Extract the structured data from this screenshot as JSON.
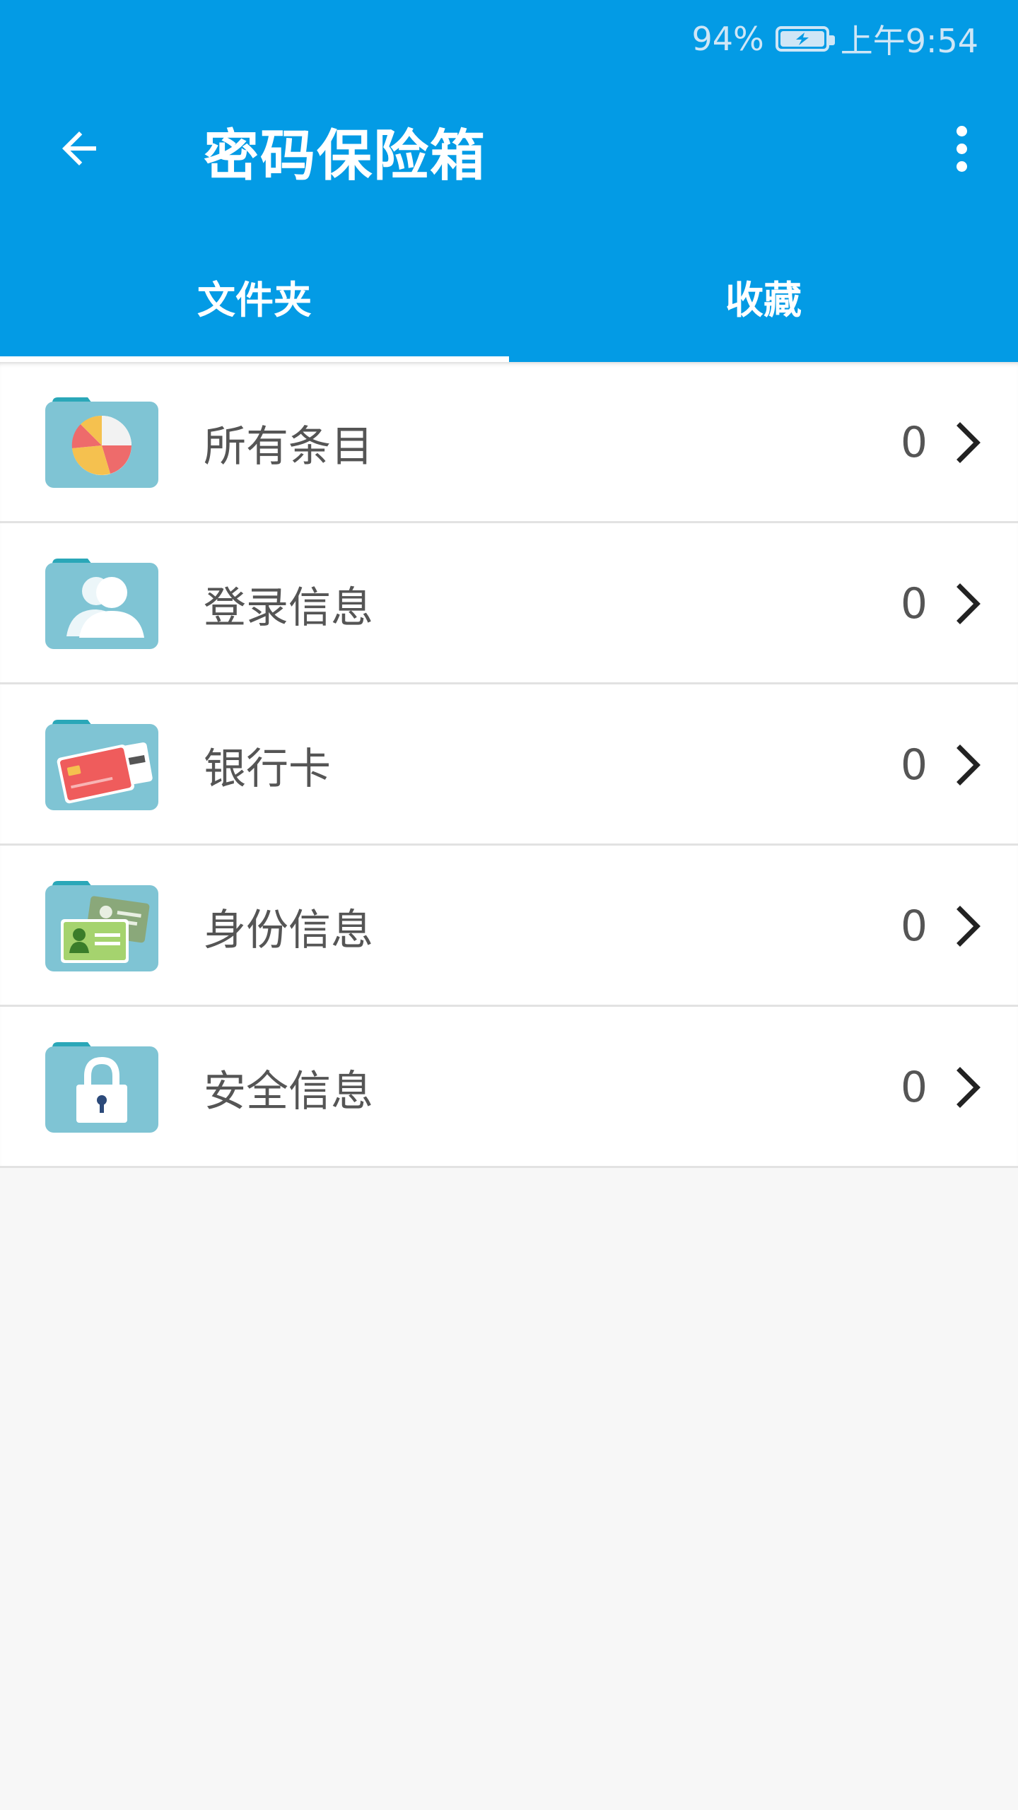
{
  "status_bar": {
    "battery_percent": "94%",
    "time": "上午9:54"
  },
  "toolbar": {
    "title": "密码保险箱",
    "back_icon": "arrow-left-icon",
    "menu_icon": "more-vert-icon"
  },
  "tabs": [
    {
      "label": "文件夹",
      "active": true
    },
    {
      "label": "收藏",
      "active": false
    }
  ],
  "colors": {
    "primary": "#039be5",
    "folder": "#7fc4d4",
    "folder_tab": "#2aa7b8",
    "background": "#f7f7f7"
  },
  "folders": [
    {
      "label": "所有条目",
      "count": "0",
      "icon": "pie-chart-folder-icon"
    },
    {
      "label": "登录信息",
      "count": "0",
      "icon": "users-folder-icon"
    },
    {
      "label": "银行卡",
      "count": "0",
      "icon": "credit-card-folder-icon"
    },
    {
      "label": "身份信息",
      "count": "0",
      "icon": "id-card-folder-icon"
    },
    {
      "label": "安全信息",
      "count": "0",
      "icon": "lock-folder-icon"
    }
  ]
}
